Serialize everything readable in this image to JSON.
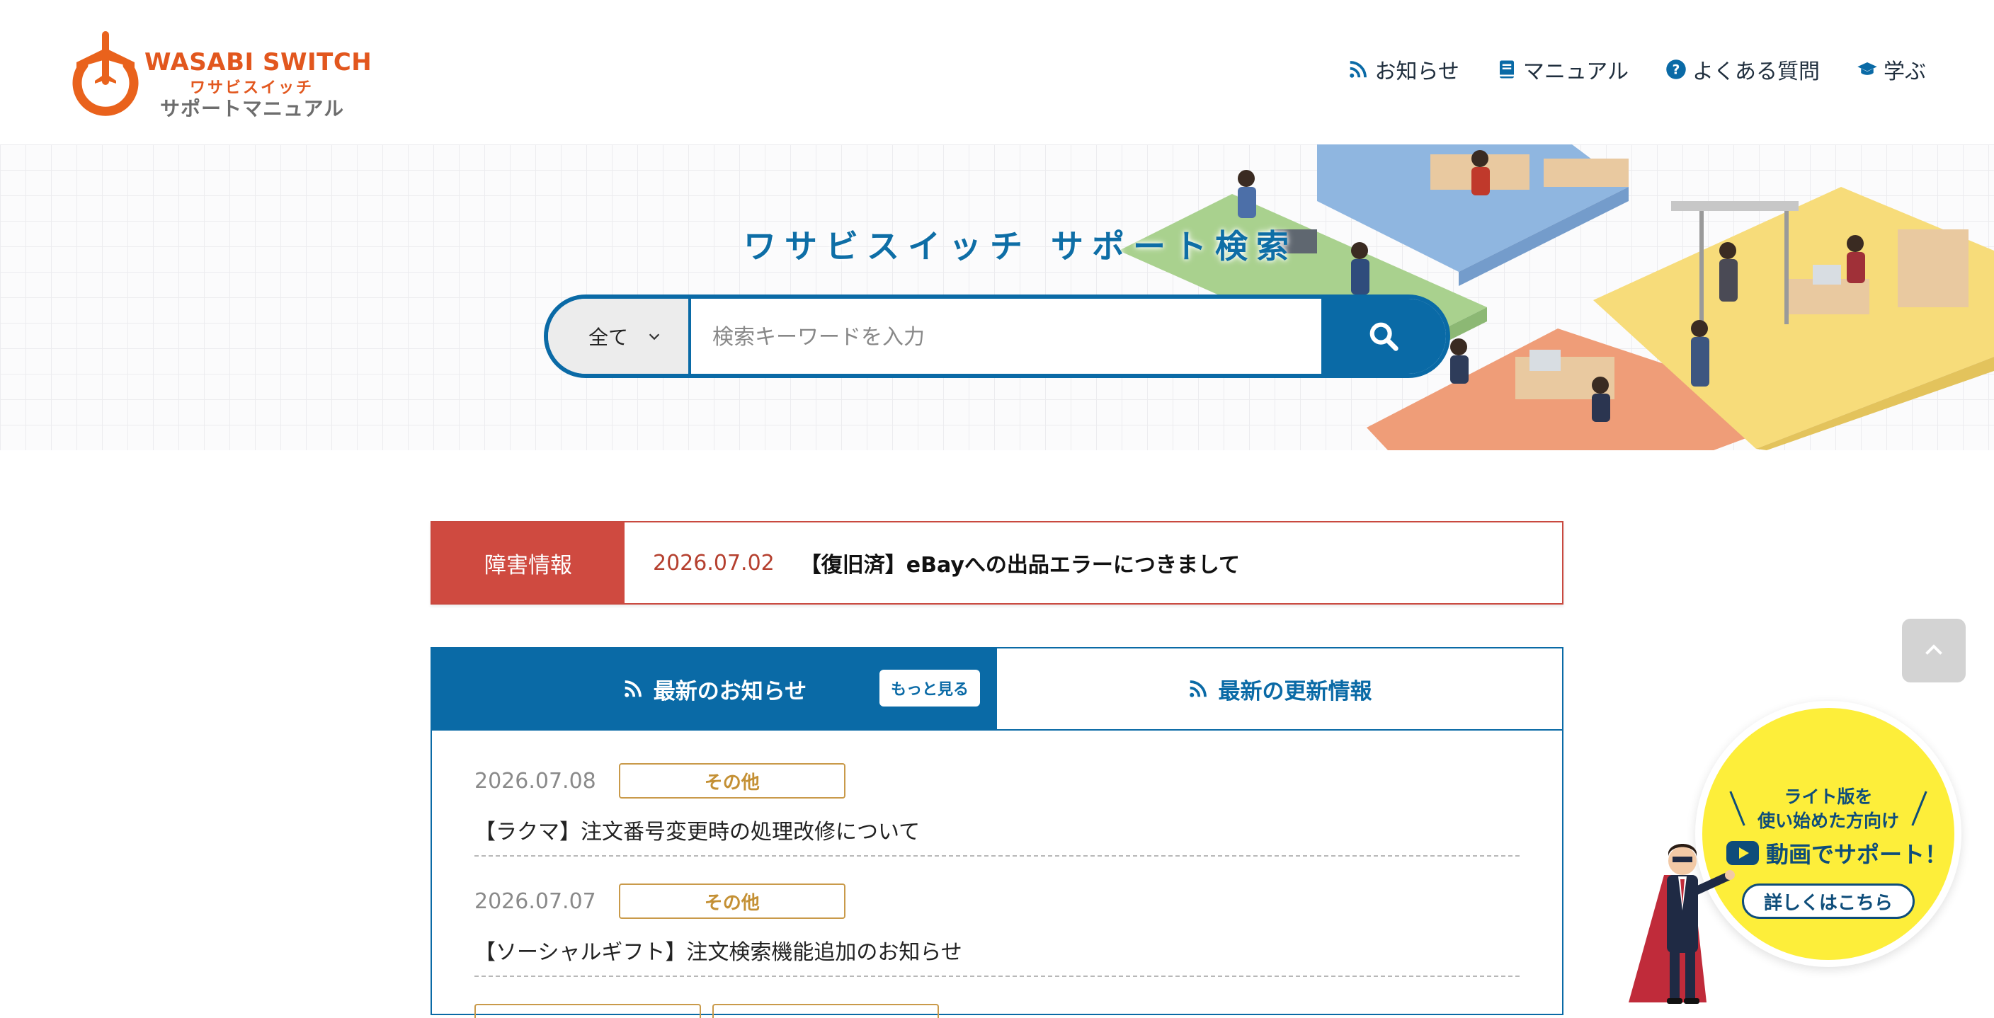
{
  "logo": {
    "brand_en": "WASABI SWITCH",
    "brand_ja": "ワサビスイッチ",
    "subtitle": "サポートマニュアル"
  },
  "nav": [
    {
      "label": "お知らせ",
      "icon": "rss-icon"
    },
    {
      "label": "マニュアル",
      "icon": "book-icon"
    },
    {
      "label": "よくある質問",
      "icon": "question-icon"
    },
    {
      "label": "学ぶ",
      "icon": "graduation-cap-icon"
    }
  ],
  "hero": {
    "title": "ワサビスイッチ サポート検索",
    "search": {
      "category": "全て",
      "placeholder": "検索キーワードを入力"
    }
  },
  "alert": {
    "label": "障害情報",
    "date": "2026.07.02",
    "text": "【復旧済】eBayへの出品エラーにつきまして"
  },
  "news": {
    "tabs": [
      {
        "label": "最新のお知らせ",
        "active": true
      },
      {
        "label": "最新の更新情報",
        "active": false
      }
    ],
    "more_label": "もっと見る",
    "items": [
      {
        "date": "2026.07.08",
        "tag": "その他",
        "title": "【ラクマ】注文番号変更時の処理改修について"
      },
      {
        "date": "2026.07.07",
        "tag": "その他",
        "title": "【ソーシャルギフト】注文検索機能追加のお知らせ"
      }
    ]
  },
  "promo": {
    "line1": "ライト版を",
    "line2": "使い始めた方向け",
    "main": "動画でサポート！",
    "button": "詳しくはこちら"
  },
  "colors": {
    "primary": "#0a6aa6",
    "alert": "#cf4a40",
    "brand": "#e2571e",
    "tag": "#c99a4a",
    "promo": "#fdee3a"
  }
}
